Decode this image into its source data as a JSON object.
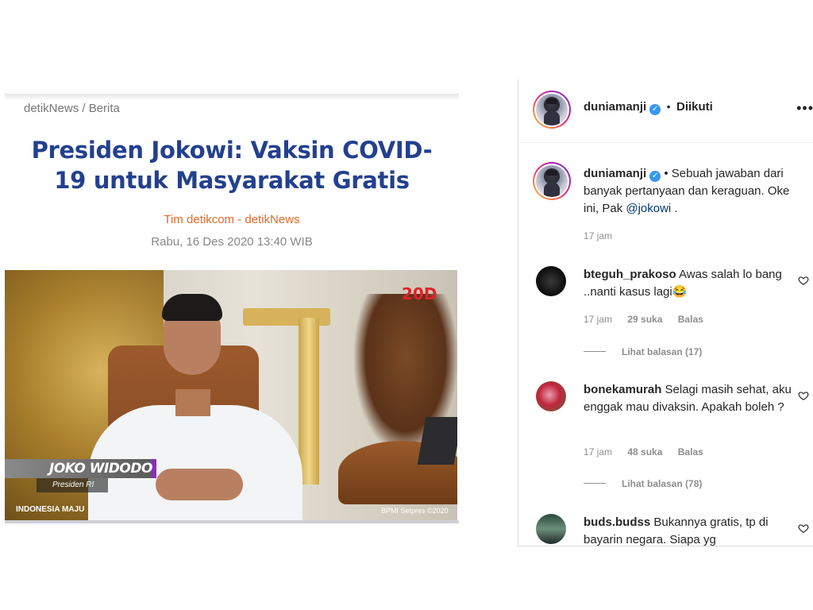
{
  "article": {
    "breadcrumb": "detikNews / Berita",
    "headline_line1": "Presiden Jokowi: Vaksin COVID-",
    "headline_line2": "19 untuk Masyarakat Gratis",
    "author": "Tim detikcom - detikNews",
    "date": "Rabu, 16 Des 2020 13:40 WIB",
    "photo": {
      "channel_logo": "20D",
      "name_lower_third": "JOKO WIDODO",
      "title_lower_third": "Presiden RI",
      "bottom_logo": "INDONESIA MAJU",
      "credit": "BPMI Setpres ©2020"
    }
  },
  "post": {
    "header": {
      "username": "duniamanji",
      "verified_glyph": "✓",
      "separator": "•",
      "follow_status": "Diikuti",
      "more_glyph": "•••"
    },
    "caption": {
      "username": "duniamanji",
      "verified_glyph": "✓",
      "separator": "•",
      "text": "Sebuah jawaban dari banyak pertanyaan dan keraguan. Oke ini, Pak ",
      "mention": "@jokowi",
      "end": " .",
      "time": "17 jam"
    },
    "comments": [
      {
        "username": "bteguh_prakoso",
        "text": "Awas salah lo bang ..nanti kasus lagi😂",
        "time": "17 jam",
        "likes": "29 suka",
        "reply_label": "Balas",
        "view_replies": "Lihat balasan (17)"
      },
      {
        "username": "bonekamurah",
        "text": "Selagi masih sehat, aku enggak mau divaksin. Apakah boleh ?",
        "time": "17 jam",
        "likes": "48 suka",
        "reply_label": "Balas",
        "view_replies": "Lihat balasan (78)"
      },
      {
        "username": "buds.budss",
        "text": "Bukannya gratis, tp di bayarin negara. Siapa yg"
      }
    ]
  },
  "icons": {
    "heart": "heart-outline-icon",
    "verified": "verified-badge-icon",
    "more": "more-options-icon"
  },
  "colors": {
    "headline": "#23408f",
    "author": "#e06a2c",
    "verified": "#3897f0",
    "mention": "#00376b",
    "meta_gray": "#8e8e8e"
  }
}
